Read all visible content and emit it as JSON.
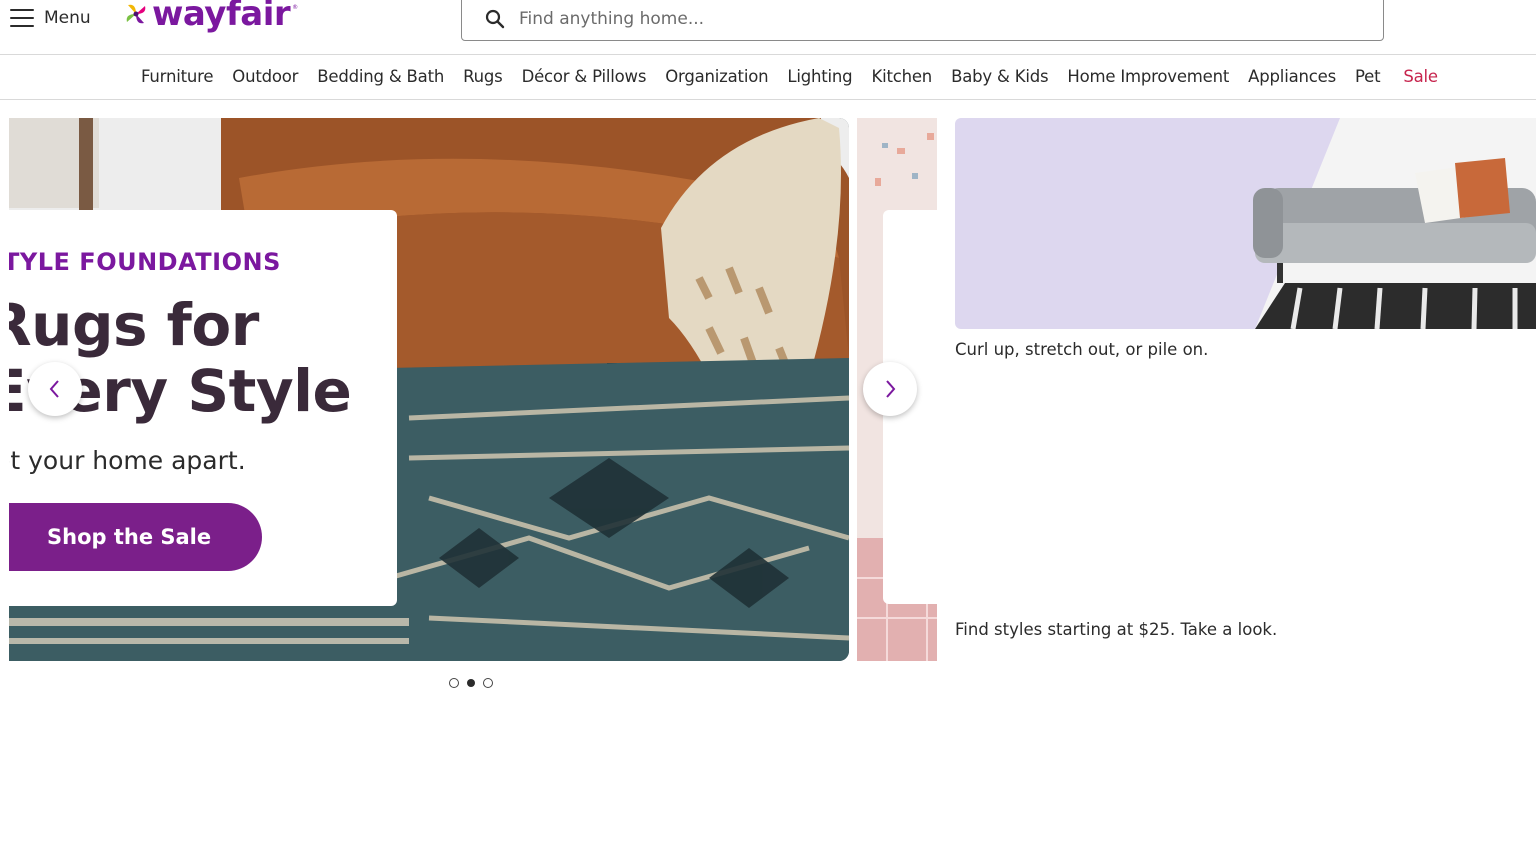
{
  "header": {
    "menu_label": "Menu",
    "logo_text": "wayfair",
    "logo_tm": "®",
    "search_placeholder": "Find anything home..."
  },
  "categories": [
    {
      "label": "Furniture"
    },
    {
      "label": "Outdoor"
    },
    {
      "label": "Bedding & Bath"
    },
    {
      "label": "Rugs"
    },
    {
      "label": "Décor & Pillows"
    },
    {
      "label": "Organization"
    },
    {
      "label": "Lighting"
    },
    {
      "label": "Kitchen"
    },
    {
      "label": "Baby & Kids"
    },
    {
      "label": "Home Improvement"
    },
    {
      "label": "Appliances"
    },
    {
      "label": "Pet"
    },
    {
      "label": "Sale"
    }
  ],
  "hero": {
    "eyebrow": "TYLE FOUNDATIONS",
    "headline": "Rugs for\nEvery Style",
    "subtext": "et your home apart.",
    "button_label": "Shop the Sale",
    "active_slide": 2,
    "slide_count": 3
  },
  "side_promo": {
    "caption": "Curl up, stretch out, or pile on.",
    "caption2": "Find styles starting at $25. Take a look."
  },
  "colors": {
    "brand_purple": "#7b189f",
    "button_purple": "#7b1f8a",
    "sale_red": "#c7254e",
    "promo_lavender": "#ddd7ef"
  },
  "icons": {
    "menu": "hamburger-icon",
    "search": "search-icon",
    "prev": "chevron-left-icon",
    "next": "chevron-right-icon",
    "logo": "wayfair-pinwheel-logo"
  }
}
